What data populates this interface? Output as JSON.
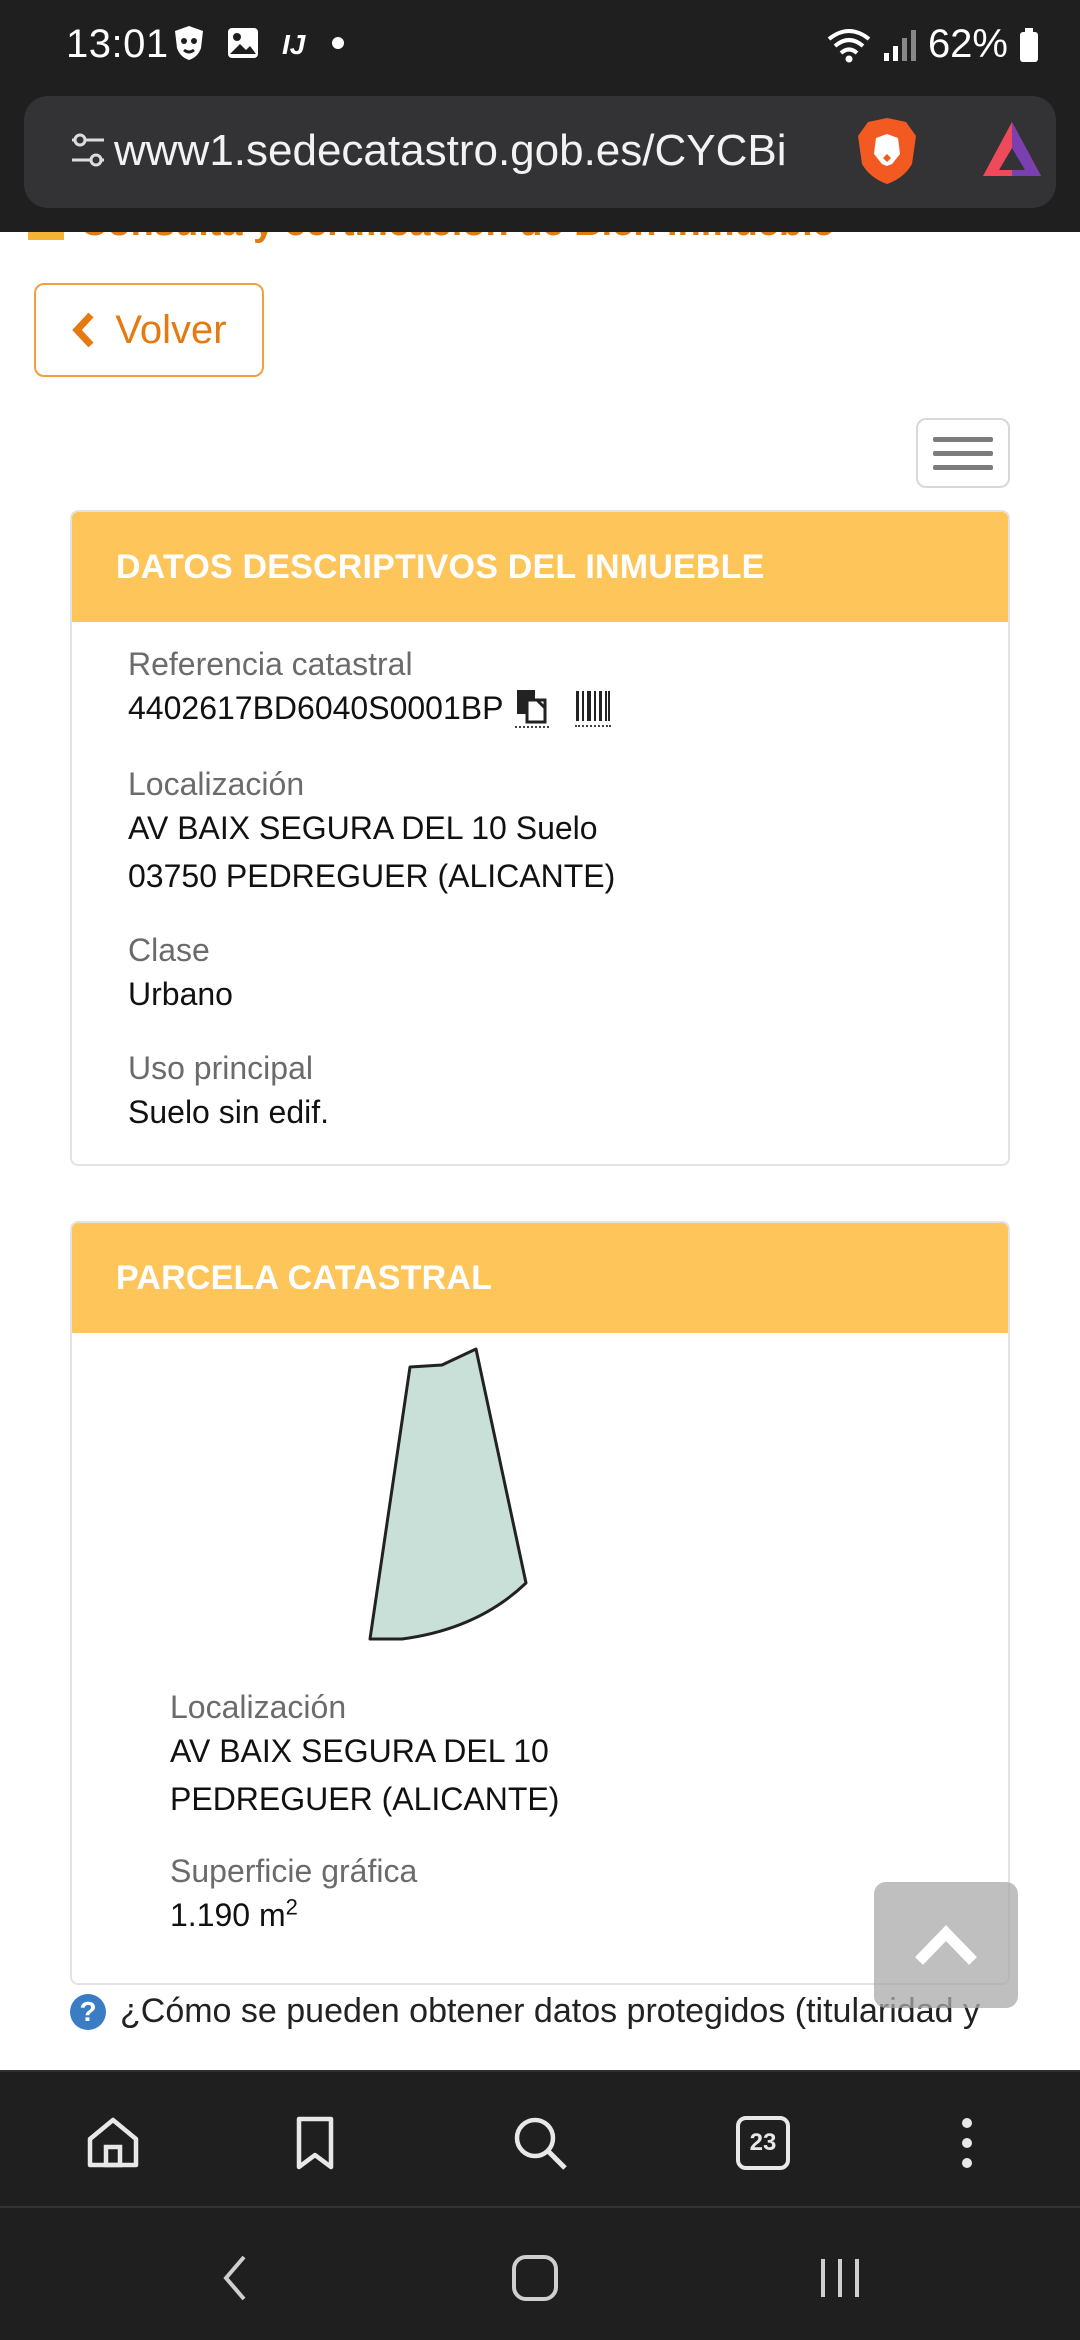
{
  "status_bar": {
    "time": "13:01",
    "battery": "62%",
    "left_icons": [
      "shield-lion-icon",
      "image-icon",
      "ij-icon",
      "dot-icon"
    ],
    "right_icons": [
      "wifi-icon",
      "signal-icon",
      "battery-icon"
    ]
  },
  "browser": {
    "url": "www1.sedecatastro.gob.es/CYCBi"
  },
  "page": {
    "header_partial": "Consulta y certificación de Bien Inmueble",
    "back_label": "Volver",
    "card1": {
      "title": "DATOS DESCRIPTIVOS DEL INMUEBLE",
      "ref_label": "Referencia catastral",
      "ref_value": "4402617BD6040S0001BP",
      "loc_label": "Localización",
      "loc_line1": "AV BAIX SEGURA DEL 10 Suelo",
      "loc_line2": "03750 PEDREGUER (ALICANTE)",
      "clase_label": "Clase",
      "clase_value": "Urbano",
      "uso_label": "Uso principal",
      "uso_value": "Suelo sin edif."
    },
    "card2": {
      "title": "PARCELA CATASTRAL",
      "loc_label": "Localización",
      "loc_line1": "AV BAIX SEGURA DEL 10",
      "loc_line2": "PEDREGUER (ALICANTE)",
      "sup_label": "Superficie gráfica",
      "sup_value": "1.190 m",
      "sup_exp": "2"
    },
    "help_text": "¿Cómo se pueden obtener datos protegidos (titularidad y"
  },
  "toolbar": {
    "tab_count": "23"
  },
  "colors": {
    "accent_orange": "#e57a10",
    "card_header": "#fec55a",
    "parcel_fill": "#c8e0d8"
  }
}
